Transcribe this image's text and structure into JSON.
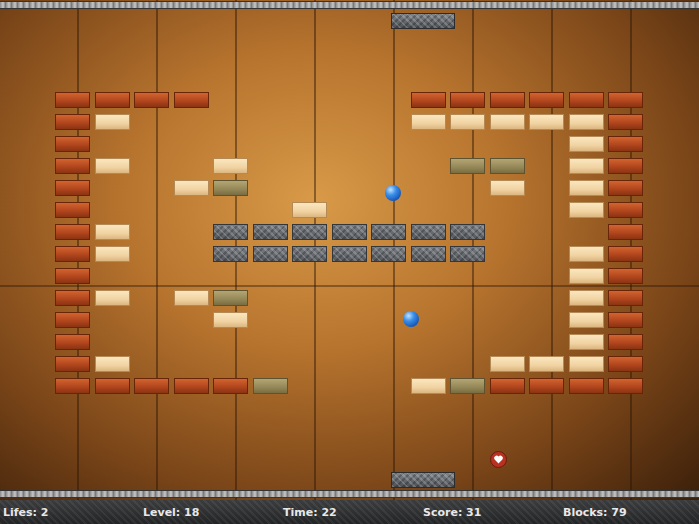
{
  "game": {
    "bricks": [
      [
        "red",
        "red",
        "red",
        "red",
        "none",
        "none",
        "none",
        "none",
        "none",
        "red",
        "red",
        "red",
        "red",
        "red",
        "red"
      ],
      [
        "red",
        "light",
        "none",
        "none",
        "none",
        "none",
        "none",
        "none",
        "none",
        "light",
        "light",
        "light",
        "light",
        "light",
        "red"
      ],
      [
        "red",
        "none",
        "none",
        "none",
        "none",
        "none",
        "none",
        "none",
        "none",
        "none",
        "none",
        "none",
        "none",
        "light",
        "red"
      ],
      [
        "red",
        "light",
        "none",
        "none",
        "light",
        "none",
        "none",
        "none",
        "none",
        "none",
        "olive",
        "olive",
        "none",
        "light",
        "red"
      ],
      [
        "red",
        "none",
        "none",
        "light",
        "olive",
        "none",
        "none",
        "none",
        "none",
        "none",
        "none",
        "light",
        "none",
        "light",
        "red"
      ],
      [
        "red",
        "none",
        "none",
        "none",
        "none",
        "none",
        "light",
        "none",
        "none",
        "none",
        "none",
        "none",
        "none",
        "light",
        "red"
      ],
      [
        "red",
        "light",
        "none",
        "none",
        "metal",
        "metal",
        "metal",
        "metal",
        "metal",
        "metal",
        "metal",
        "none",
        "none",
        "none",
        "red"
      ],
      [
        "red",
        "light",
        "none",
        "none",
        "metal",
        "metal",
        "metal",
        "metal",
        "metal",
        "metal",
        "metal",
        "none",
        "none",
        "light",
        "red"
      ],
      [
        "red",
        "none",
        "none",
        "none",
        "none",
        "none",
        "none",
        "none",
        "none",
        "none",
        "none",
        "none",
        "none",
        "light",
        "red"
      ],
      [
        "red",
        "light",
        "none",
        "light",
        "olive",
        "none",
        "none",
        "none",
        "none",
        "none",
        "none",
        "none",
        "none",
        "light",
        "red"
      ],
      [
        "red",
        "none",
        "none",
        "none",
        "light",
        "none",
        "none",
        "none",
        "none",
        "none",
        "none",
        "none",
        "none",
        "light",
        "red"
      ],
      [
        "red",
        "none",
        "none",
        "none",
        "none",
        "none",
        "none",
        "none",
        "none",
        "none",
        "none",
        "none",
        "none",
        "light",
        "red"
      ],
      [
        "red",
        "light",
        "none",
        "none",
        "none",
        "none",
        "none",
        "none",
        "none",
        "none",
        "none",
        "light",
        "light",
        "light",
        "red"
      ],
      [
        "red",
        "red",
        "red",
        "red",
        "red",
        "olive",
        "none",
        "none",
        "none",
        "light",
        "olive",
        "red",
        "red",
        "red",
        "red"
      ]
    ],
    "balls": [
      {
        "kind": "ball"
      },
      {
        "kind": "ball"
      }
    ],
    "paddles": [
      {
        "side": "top"
      },
      {
        "side": "bottom"
      }
    ],
    "powerups": [
      {
        "kind": "life"
      }
    ]
  },
  "status_bar": [
    "Lifes: 2",
    "Level: 18",
    "Time: 22",
    "Score: 31",
    "Blocks: 79"
  ]
}
